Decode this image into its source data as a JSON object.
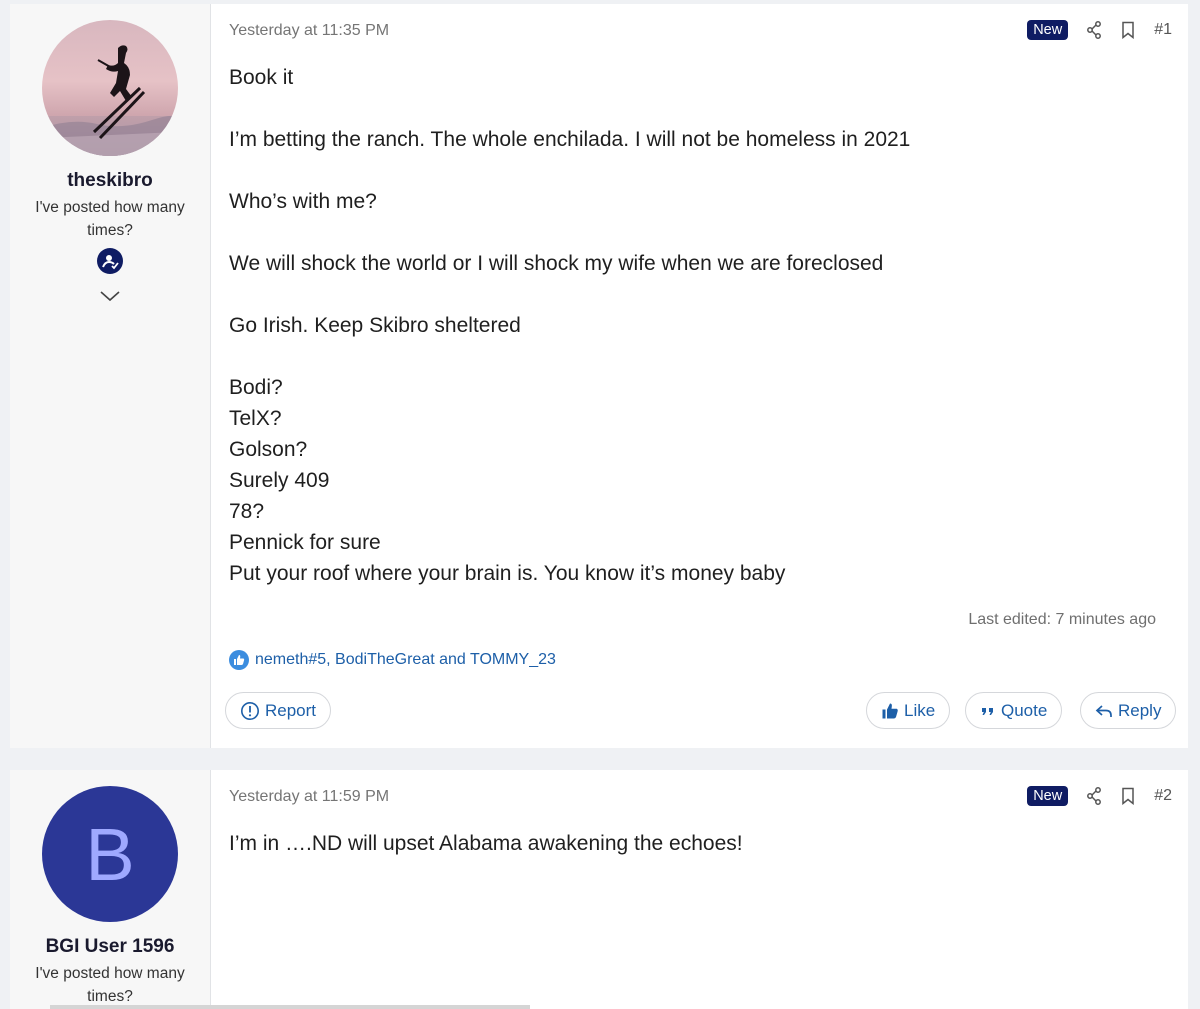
{
  "posts": [
    {
      "username": "theskibro",
      "user_title": "I've posted how many times?",
      "avatar_icon": "skier-photo",
      "date": "Yesterday at 11:35 PM",
      "new_badge": "New",
      "post_number": "#1",
      "lines": {
        "l1": "Book it",
        "l2": "I’m betting the ranch. The whole enchilada. I will not be homeless in 2021",
        "l3": "Who’s with me?",
        "l4": "We will shock the world or I will shock my wife when we are foreclosed",
        "l5": "Go Irish. Keep Skibro sheltered",
        "l6": "Bodi?",
        "l7": "TelX?",
        "l8": "Golson?",
        "l9": "Surely 409",
        "l10": "78?",
        "l11": "Pennick for sure",
        "l12": "Put your roof where your brain is. You know it’s money baby"
      },
      "last_edited": "Last edited: 7 minutes ago",
      "reactions_text": "nemeth#5, BodiTheGreat and TOMMY_23",
      "buttons": {
        "report": "Report",
        "like": "Like",
        "quote": "Quote",
        "reply": "Reply"
      }
    },
    {
      "username": "BGI User 1596",
      "user_title": "I've posted how many times?",
      "avatar_letter": "B",
      "date": "Yesterday at 11:59 PM",
      "new_badge": "New",
      "post_number": "#2",
      "lines": {
        "l1": "I’m in ….ND will upset Alabama awakening the echoes!"
      }
    }
  ],
  "colors": {
    "accent": "#1d5fa8",
    "new_badge_bg": "#0f1c63",
    "avatar_b_bg": "#2b3796",
    "page_bg": "#eff1f4"
  }
}
